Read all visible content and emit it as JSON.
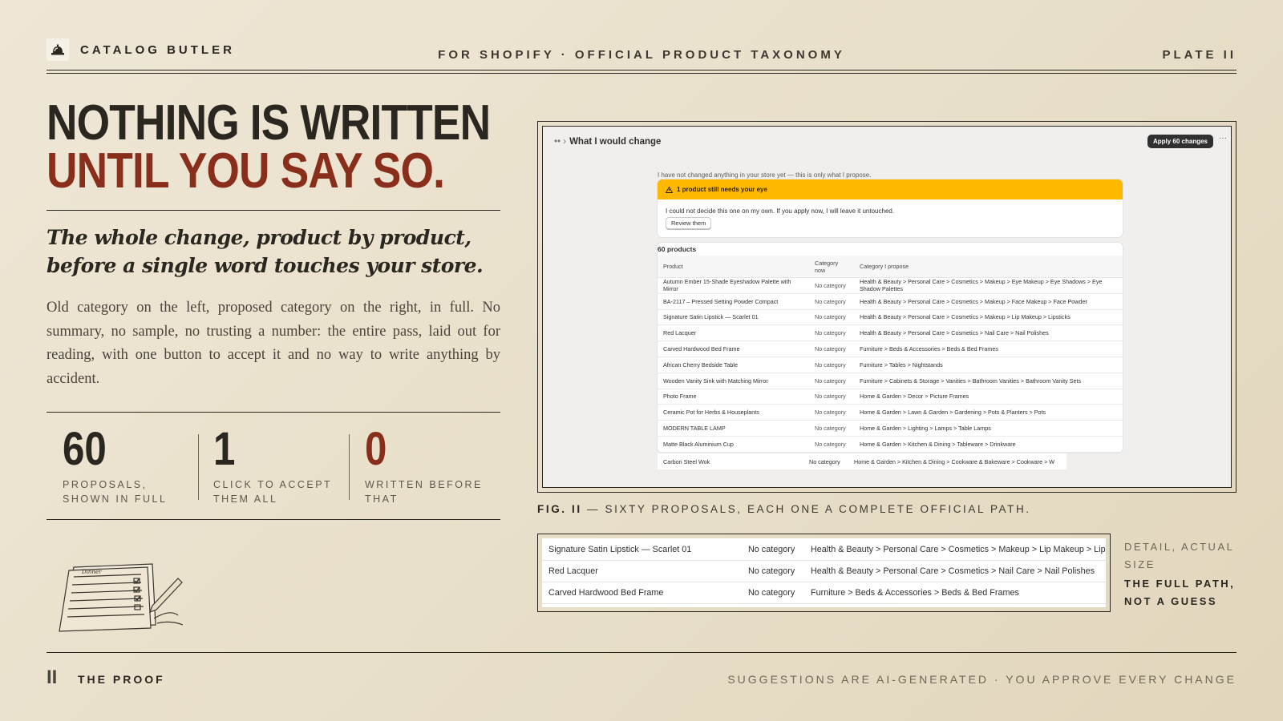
{
  "header": {
    "brand": "CATALOG BUTLER",
    "brand_icon": "service-bell-icon",
    "tagline": "FOR SHOPIFY · OFFICIAL PRODUCT TAXONOMY",
    "plate": "PLATE II"
  },
  "headline": {
    "line1": "NOTHING IS WRITTEN",
    "line2": "UNTIL YOU SAY SO."
  },
  "subheadline": "The whole change, product by product, before a single word touches your store.",
  "body": "Old category on the left, proposed category on the right, in full. No summary, no sample, no trusting a number: the entire pass, laid out for reading, with one button to accept it and no way to write anything by accident.",
  "stats": [
    {
      "value": "60",
      "label": "PROPOSALS, SHOWN IN FULL",
      "color": "#2a2620"
    },
    {
      "value": "1",
      "label": "CLICK TO ACCEPT THEM ALL",
      "color": "#2a2620"
    },
    {
      "value": "0",
      "label": "WRITTEN BEFORE THAT",
      "color": "#8a2e1c"
    }
  ],
  "app": {
    "breadcrumb_prefix": "•• ›",
    "title": "What I would change",
    "apply_button": "Apply 60 changes",
    "more_icon": "ellipsis-icon",
    "note": "I have not changed anything in your store yet — this is only what I propose.",
    "banner": {
      "title": "1 product still needs your eye",
      "icon": "warning-triangle-icon",
      "text": "I could not decide this one on my own. If you apply now, I will leave it untouched.",
      "button": "Review them"
    },
    "table_title": "60 products",
    "columns": [
      "Product",
      "Category now",
      "Category I propose"
    ],
    "rows": [
      [
        "Autumn Ember 15-Shade Eyeshadow Palette with Mirror",
        "No category",
        "Health & Beauty > Personal Care > Cosmetics > Makeup > Eye Makeup > Eye Shadows > Eye Shadow Palettes"
      ],
      [
        "BA-2117 – Pressed Setting Powder Compact",
        "No category",
        "Health & Beauty > Personal Care > Cosmetics > Makeup > Face Makeup > Face Powder"
      ],
      [
        "Signature Satin Lipstick — Scarlet 01",
        "No category",
        "Health & Beauty > Personal Care > Cosmetics > Makeup > Lip Makeup > Lipsticks"
      ],
      [
        "Red Lacquer",
        "No category",
        "Health & Beauty > Personal Care > Cosmetics > Nail Care > Nail Polishes"
      ],
      [
        "Carved Hardwood Bed Frame",
        "No category",
        "Furniture > Beds & Accessories > Beds & Bed Frames"
      ],
      [
        "African Cherry Bedside Table",
        "No category",
        "Furniture > Tables > Nightstands"
      ],
      [
        "Wooden Vanity Sink with Matching Mirror",
        "No category",
        "Furniture > Cabinets & Storage > Vanities > Bathroom Vanities > Bathroom Vanity Sets"
      ],
      [
        "Photo Frame",
        "No category",
        "Home & Garden > Decor > Picture Frames"
      ],
      [
        "Ceramic Pot for Herbs & Houseplants",
        "No category",
        "Home & Garden > Lawn & Garden > Gardening > Pots & Planters > Pots"
      ],
      [
        "MODERN TABLE LAMP",
        "No category",
        "Home & Garden > Lighting > Lamps > Table Lamps"
      ],
      [
        "Matte Black Aluminium Cup",
        "No category",
        "Home & Garden > Kitchen & Dining > Tableware > Drinkware"
      ]
    ],
    "cut_row": [
      "Carbon Steel Wok",
      "No category",
      "Home & Garden > Kitchen & Dining > Cookware & Bakeware > Cookware > W"
    ]
  },
  "figure_caption": {
    "label": "FIG. II",
    "text": " — SIXTY PROPOSALS, EACH ONE A COMPLETE OFFICIAL PATH."
  },
  "detail": {
    "rows": [
      [
        "Signature Satin Lipstick — Scarlet 01",
        "No category",
        "Health & Beauty > Personal Care > Cosmetics > Makeup > Lip Makeup > Lips"
      ],
      [
        "Red Lacquer",
        "No category",
        "Health & Beauty > Personal Care > Cosmetics > Nail Care > Nail Polishes"
      ],
      [
        "Carved Hardwood Bed Frame",
        "No category",
        "Furniture > Beds & Accessories > Beds & Bed Frames"
      ]
    ],
    "label1": "DETAIL, ACTUAL SIZE",
    "label2": "THE FULL PATH, NOT A GUESS"
  },
  "footer": {
    "numeral": "II",
    "section": "THE PROOF",
    "disclaimer": "SUGGESTIONS ARE AI-GENERATED · YOU APPROVE EVERY CHANGE"
  },
  "illustration_icon": "checklist-form-with-pen-icon"
}
